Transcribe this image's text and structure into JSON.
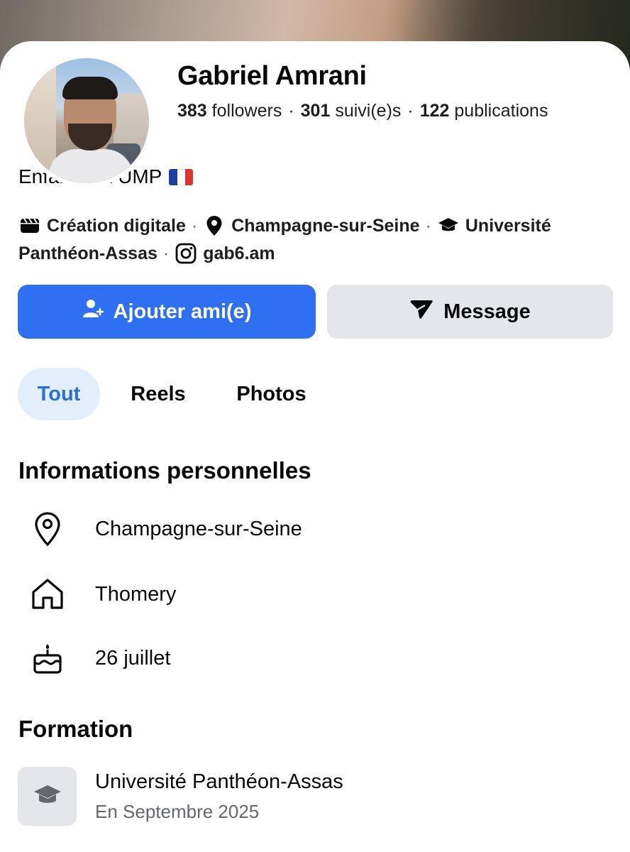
{
  "profile": {
    "name": "Gabriel Amrani",
    "followers_count": "383",
    "followers_label": "followers",
    "following_count": "301",
    "following_label": "suivi(e)s",
    "posts_count": "122",
    "posts_label": "publications",
    "bio": "Enfant de l’UMP",
    "bio_flag": "french-flag-icon"
  },
  "meta": {
    "category": "Création digitale",
    "location": "Champagne-sur-Seine",
    "school_part1": "Université",
    "school_part2": "Panthéon-Assas",
    "instagram": "gab6.am",
    "separator": "·"
  },
  "actions": {
    "add_friend": "Ajouter ami(e)",
    "message": "Message"
  },
  "tabs": [
    {
      "label": "Tout",
      "active": true
    },
    {
      "label": "Reels",
      "active": false
    },
    {
      "label": "Photos",
      "active": false
    }
  ],
  "personal_info": {
    "title": "Informations personnelles",
    "rows": [
      {
        "icon": "location-pin-icon",
        "text": "Champagne-sur-Seine"
      },
      {
        "icon": "home-icon",
        "text": "Thomery"
      },
      {
        "icon": "birthday-cake-icon",
        "text": "26 juillet"
      }
    ]
  },
  "education": {
    "title": "Formation",
    "school": "Université Panthéon-Assas",
    "date": "En Septembre 2025",
    "icon": "graduation-cap-icon"
  },
  "colors": {
    "primary_blue": "#2f6ff1",
    "tab_active_bg": "#e3eefc",
    "tab_active_text": "#2d6fd8",
    "secondary_button": "#e4e6eb"
  }
}
